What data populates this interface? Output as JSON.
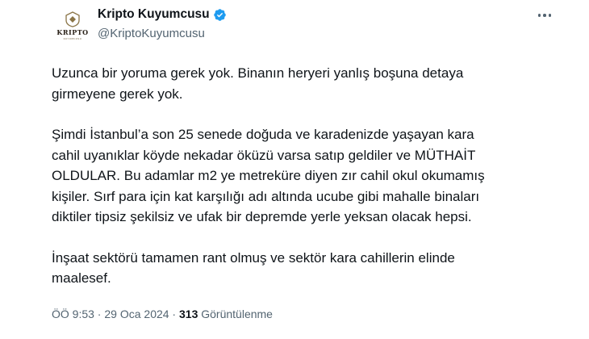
{
  "author": {
    "display_name": "Kripto Kuyumcusu",
    "handle": "@KriptoKuyumcusu",
    "avatar_brand": "KRIPTO",
    "avatar_sub": "KUYUMCUSU",
    "verified": true
  },
  "colors": {
    "verified_badge": "#1d9bf0",
    "text_primary": "#0f1419",
    "text_secondary": "#536471"
  },
  "icons": {
    "verified": "verified-badge-icon",
    "more": "more-options-icon"
  },
  "body": {
    "paragraphs": [
      {
        "lines": [
          "Uzunca bir yoruma gerek yok. Binanın heryeri yanlış boşuna detaya",
          "girmeyene gerek yok."
        ]
      },
      {
        "lines": [
          "Şimdi İstanbul’a son 25 senede doğuda ve karadenizde yaşayan kara",
          "cahil uyanıklar köyde nekadar öküzü varsa satıp geldiler ve MÜTHAİT",
          "OLDULAR. Bu adamlar m2 ye metreküre diyen zır cahil okul okumamış",
          "kişiler. Sırf para için kat karşılığı adı altında ucube gibi mahalle binaları",
          "diktiler tipsiz şekilsiz ve ufak bir depremde yerle yeksan olacak hepsi."
        ]
      },
      {
        "lines": [
          "İnşaat sektörü tamamen rant olmuş ve sektör kara cahillerin elinde",
          "maalesef."
        ]
      }
    ]
  },
  "meta": {
    "time": "ÖÖ 9:53",
    "separator": " · ",
    "date": "29 Oca 2024",
    "views_count": "313",
    "views_label": " Görüntülenme"
  }
}
